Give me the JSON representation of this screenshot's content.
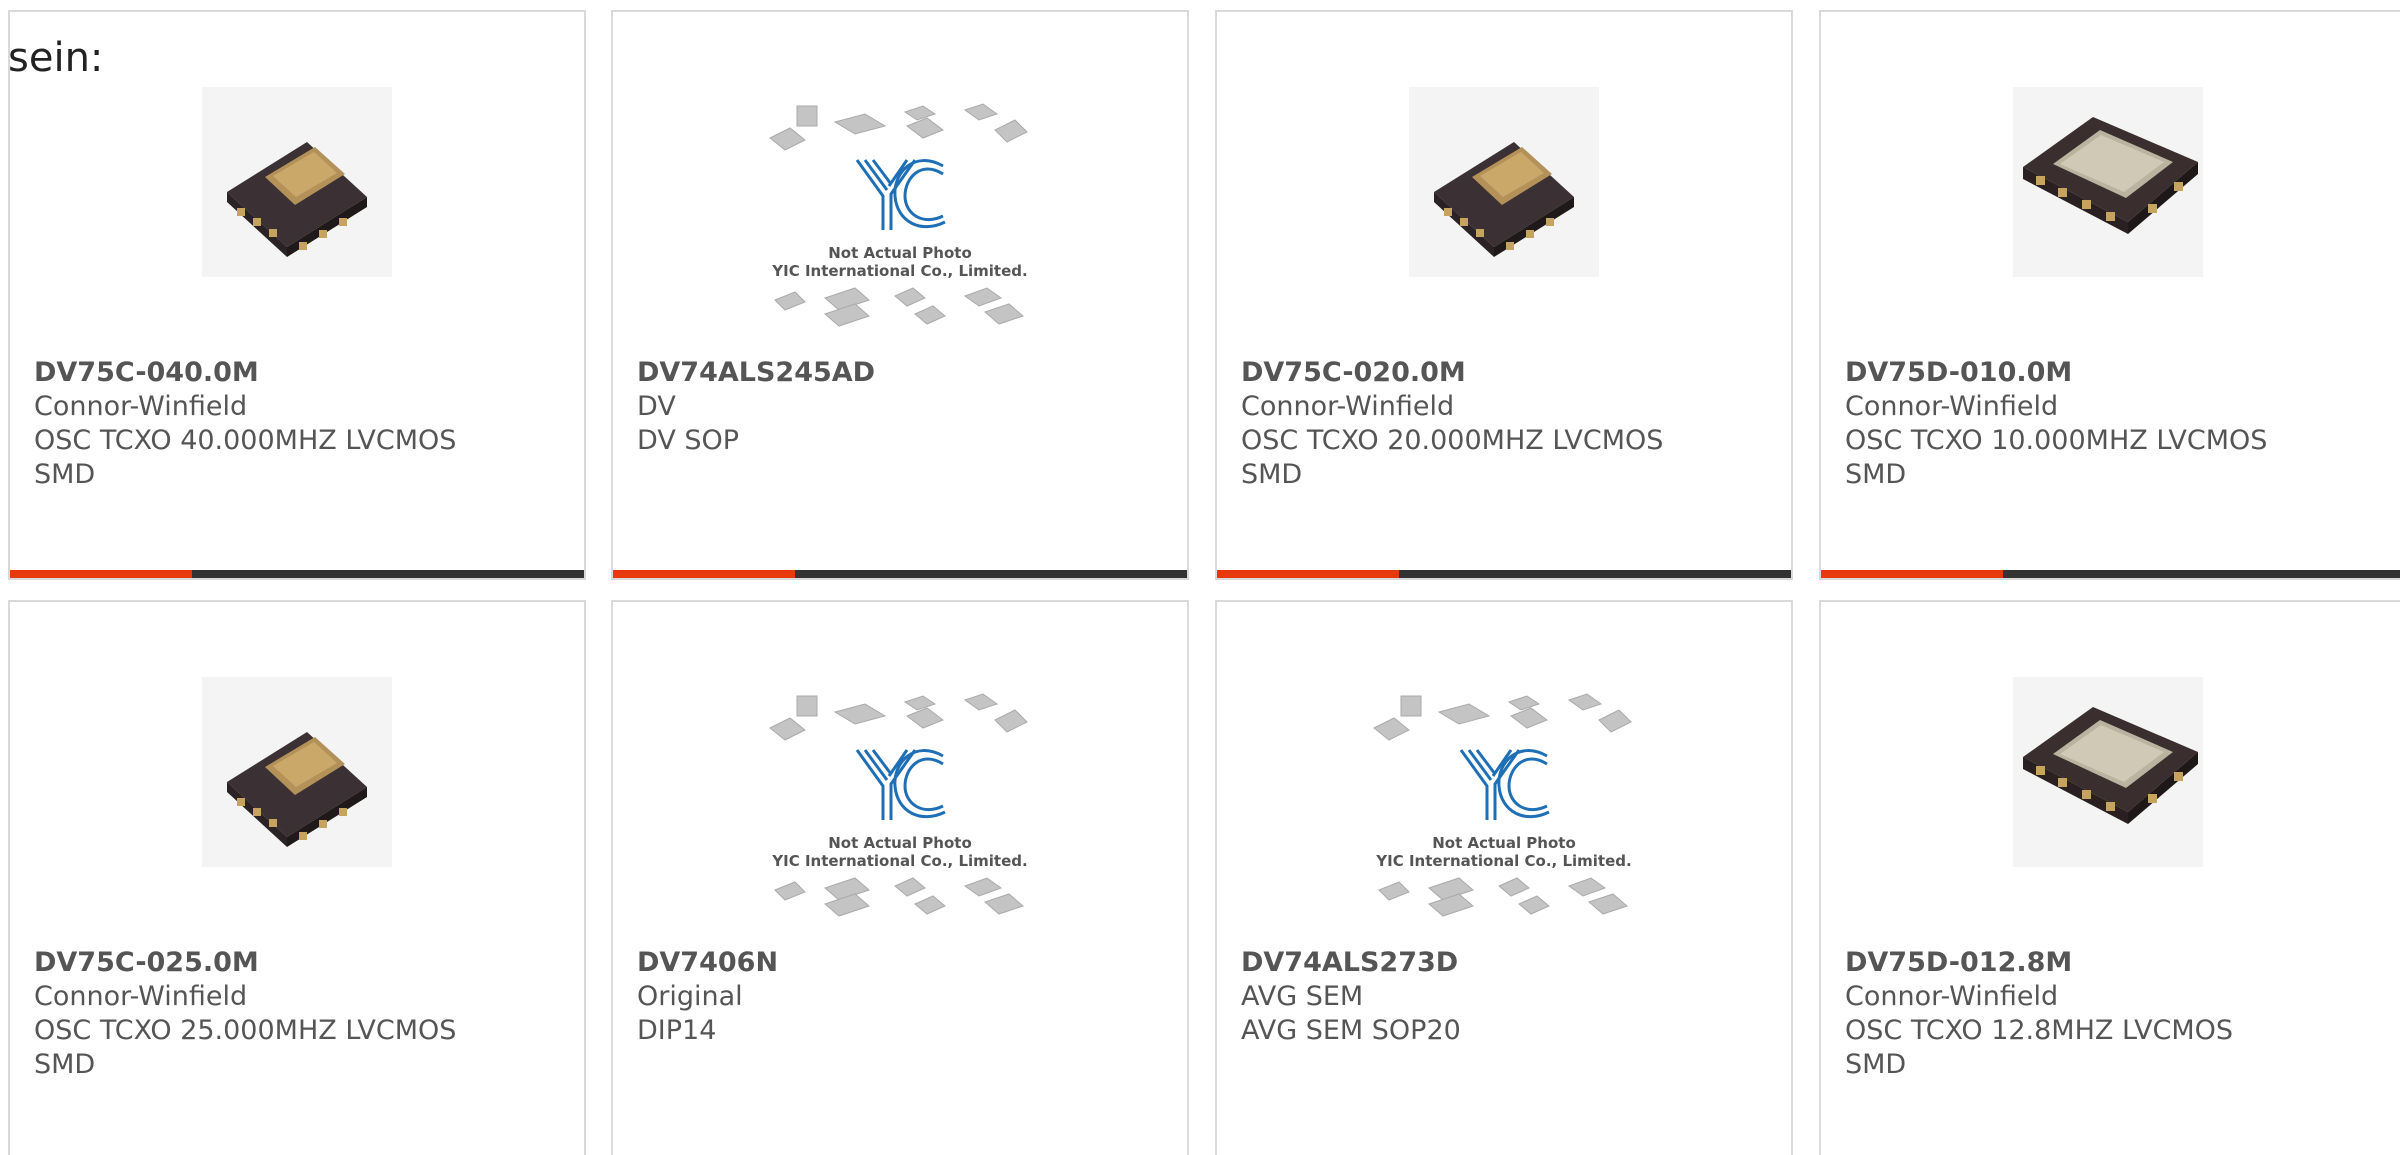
{
  "intro_text": "sein:",
  "colors": {
    "accent": "#e8380d",
    "bar": "#333333",
    "border": "#d9d9d9",
    "text": "#555555",
    "logo_blue": "#1f6fb6"
  },
  "products": [
    {
      "part_number": "DV75C-040.0M",
      "manufacturer": "Connor-Winfield",
      "desc_line1": "OSC TCXO 40.000MHZ LVCMOS",
      "desc_line2": "SMD",
      "image": "tcxo-small-icon"
    },
    {
      "part_number": "DV74ALS245AD",
      "manufacturer": "DV",
      "desc_line1": "DV SOP",
      "desc_line2": "",
      "image": "placeholder-photo",
      "placeholder_line1": "Not Actual Photo",
      "placeholder_line2": "YIC International Co., Limited."
    },
    {
      "part_number": "DV75C-020.0M",
      "manufacturer": "Connor-Winfield",
      "desc_line1": "OSC TCXO 20.000MHZ LVCMOS",
      "desc_line2": "SMD",
      "image": "tcxo-small-icon"
    },
    {
      "part_number": "DV75D-010.0M",
      "manufacturer": "Connor-Winfield",
      "desc_line1": "OSC TCXO 10.000MHZ LVCMOS",
      "desc_line2": "SMD",
      "image": "tcxo-large-icon"
    },
    {
      "part_number": "DV75C-025.0M",
      "manufacturer": "Connor-Winfield",
      "desc_line1": "OSC TCXO 25.000MHZ LVCMOS",
      "desc_line2": "SMD",
      "image": "tcxo-small-icon"
    },
    {
      "part_number": "DV7406N",
      "manufacturer": "Original",
      "desc_line1": "DIP14",
      "desc_line2": "",
      "image": "placeholder-photo",
      "placeholder_line1": "Not Actual Photo",
      "placeholder_line2": "YIC International Co., Limited."
    },
    {
      "part_number": "DV74ALS273D",
      "manufacturer": "AVG SEM",
      "desc_line1": "AVG SEM SOP20",
      "desc_line2": "",
      "image": "placeholder-photo",
      "placeholder_line1": "Not Actual Photo",
      "placeholder_line2": "YIC International Co., Limited."
    },
    {
      "part_number": "DV75D-012.8M",
      "manufacturer": "Connor-Winfield",
      "desc_line1": "OSC TCXO 12.8MHZ LVCMOS",
      "desc_line2": "SMD",
      "image": "tcxo-large-icon"
    }
  ]
}
